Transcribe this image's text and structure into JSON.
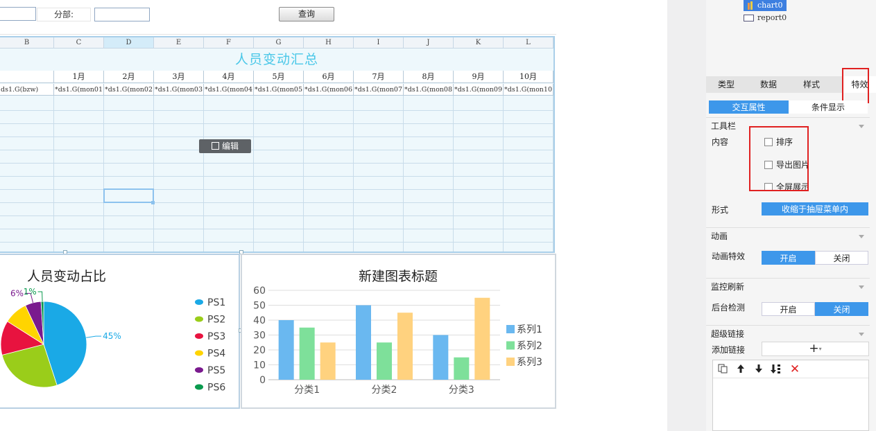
{
  "query_bar": {
    "dept_label": "分部:",
    "query_button": "查询"
  },
  "sheet": {
    "columns": [
      "B",
      "C",
      "D",
      "E",
      "F",
      "G",
      "H",
      "I",
      "J",
      "K",
      "L"
    ],
    "title": "人员变动汇总",
    "months": [
      "1月",
      "2月",
      "3月",
      "4月",
      "5月",
      "6月",
      "7月",
      "8月",
      "9月",
      "10月"
    ],
    "formulas": [
      "ds1.G(bzw)",
      "ds1.G(mon01",
      "ds1.G(mon02",
      "ds1.G(mon03",
      "ds1.G(mon04",
      "ds1.G(mon05",
      "ds1.G(mon06",
      "ds1.G(mon07",
      "ds1.G(mon08",
      "ds1.G(mon09",
      "ds1.G(mon10"
    ],
    "edit_button": "编辑"
  },
  "chart_data": [
    {
      "type": "pie",
      "title": "人员变动占比",
      "slices": [
        {
          "name": "PS1",
          "value": 45,
          "color": "#1aa9e6"
        },
        {
          "name": "PS2",
          "value": 26,
          "color": "#9acd1a"
        },
        {
          "name": "PS3",
          "value": 13,
          "color": "#e8133f"
        },
        {
          "name": "PS4",
          "value": 9,
          "color": "#ffd400"
        },
        {
          "name": "PS5",
          "value": 6,
          "color": "#7a1a8e"
        },
        {
          "name": "PS6",
          "value": 1,
          "color": "#0a9a4e"
        }
      ],
      "data_labels": [
        "45%",
        "6%",
        "1%"
      ],
      "legend_position": "right"
    },
    {
      "type": "bar",
      "title": "新建图表标题",
      "categories": [
        "分类1",
        "分类2",
        "分类3"
      ],
      "series": [
        {
          "name": "系列1",
          "values": [
            40,
            50,
            30
          ],
          "color": "#6ab8f0"
        },
        {
          "name": "系列2",
          "values": [
            35,
            25,
            15
          ],
          "color": "#7ee09a"
        },
        {
          "name": "系列3",
          "values": [
            25,
            45,
            55
          ],
          "color": "#ffd27f"
        }
      ],
      "ylim": [
        0,
        60
      ],
      "yticks": [
        0,
        10,
        20,
        30,
        40,
        50,
        60
      ],
      "grid": true,
      "legend_position": "right"
    }
  ],
  "panel": {
    "tree": [
      "chart0",
      "report0"
    ],
    "tabs": [
      "类型",
      "数据",
      "样式",
      "特效"
    ],
    "subtabs": [
      "交互属性",
      "条件显示"
    ],
    "toolbar_section": "工具栏",
    "content_label": "内容",
    "checkboxes": [
      "排序",
      "导出图片",
      "全屏展示"
    ],
    "form_label": "形式",
    "form_value": "收缩于抽屉菜单内",
    "animation_section": "动画",
    "animation_label": "动画特效",
    "on": "开启",
    "off": "关闭",
    "monitor_section": "监控刷新",
    "backend_label": "后台检测",
    "hyperlink_section": "超级链接",
    "add_link_label": "添加链接"
  }
}
